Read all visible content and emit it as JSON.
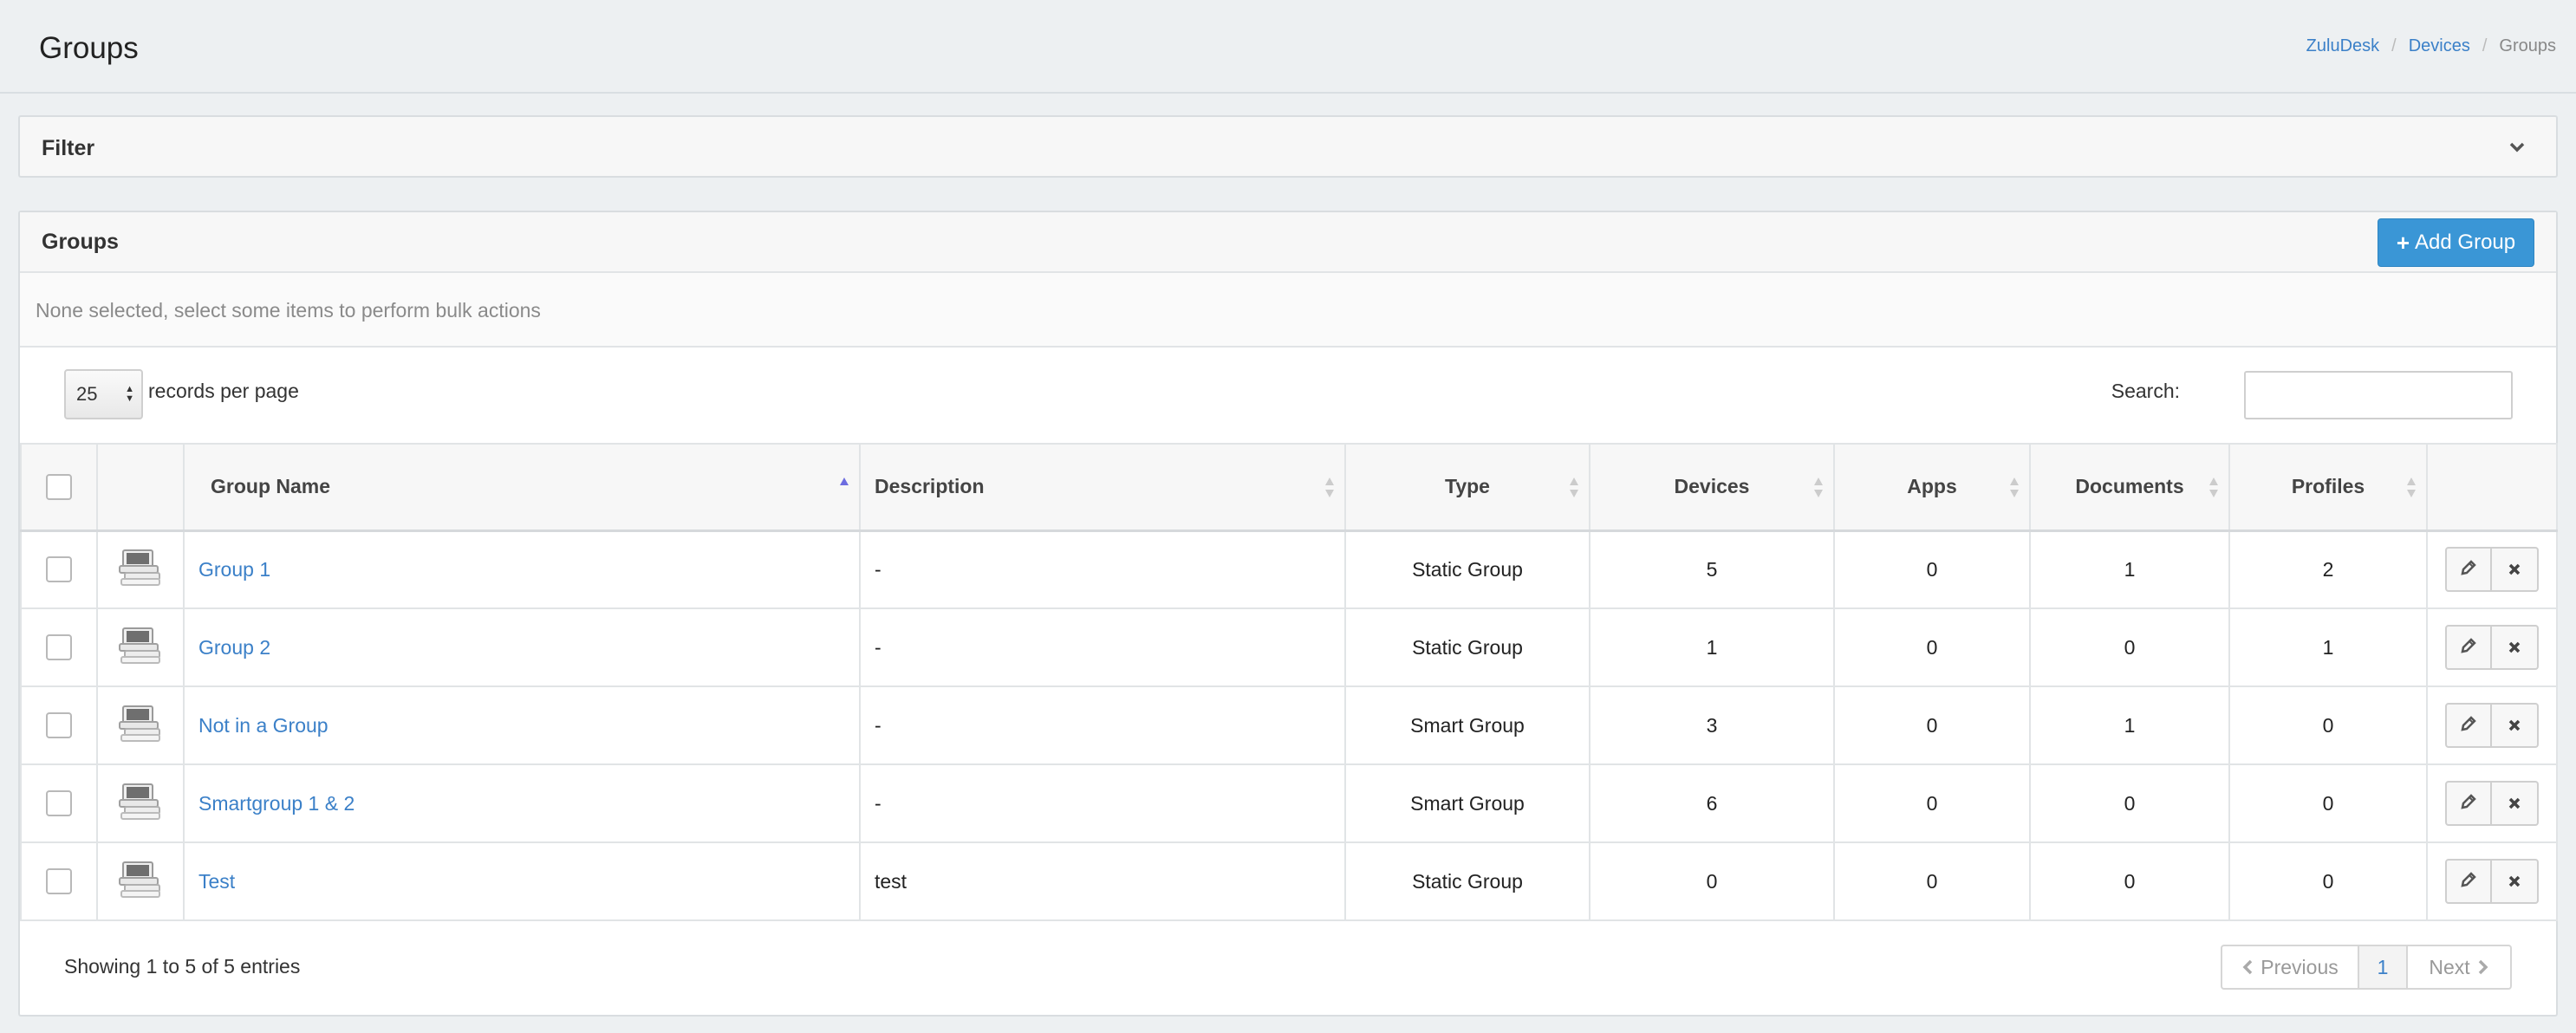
{
  "page": {
    "title": "Groups"
  },
  "breadcrumb": {
    "items": [
      "ZuluDesk",
      "Devices"
    ],
    "current": "Groups"
  },
  "filter": {
    "title": "Filter"
  },
  "groups_panel": {
    "title": "Groups",
    "add_button": "Add Group",
    "bulk_text": "None selected, select some items to perform bulk actions",
    "records_per_page": "25",
    "records_label": "records per page",
    "search_label": "Search:",
    "search_value": ""
  },
  "table": {
    "columns": [
      "Group Name",
      "Description",
      "Type",
      "Devices",
      "Apps",
      "Documents",
      "Profiles"
    ],
    "rows": [
      {
        "name": "Group 1",
        "description": "-",
        "type": "Static Group",
        "devices": "5",
        "apps": "0",
        "documents": "1",
        "profiles": "2"
      },
      {
        "name": "Group 2",
        "description": "-",
        "type": "Static Group",
        "devices": "1",
        "apps": "0",
        "documents": "0",
        "profiles": "1"
      },
      {
        "name": "Not in a Group",
        "description": "-",
        "type": "Smart Group",
        "devices": "3",
        "apps": "0",
        "documents": "1",
        "profiles": "0"
      },
      {
        "name": "Smartgroup 1 & 2",
        "description": "-",
        "type": "Smart Group",
        "devices": "6",
        "apps": "0",
        "documents": "0",
        "profiles": "0"
      },
      {
        "name": "Test",
        "description": "test",
        "type": "Static Group",
        "devices": "0",
        "apps": "0",
        "documents": "0",
        "profiles": "0"
      }
    ]
  },
  "footer": {
    "info": "Showing 1 to 5 of 5 entries",
    "prev": "Previous",
    "page": "1",
    "next": "Next"
  },
  "icons": {
    "chevron": "chevron-down-icon",
    "plus": "plus-icon",
    "row_icon": "device-stack-icon",
    "edit": "pencil-icon",
    "delete": "close-icon",
    "sort": "sort-icon"
  },
  "colors": {
    "primary": "#3a96d6",
    "link": "#3b80c8",
    "background": "#edf0f2"
  }
}
